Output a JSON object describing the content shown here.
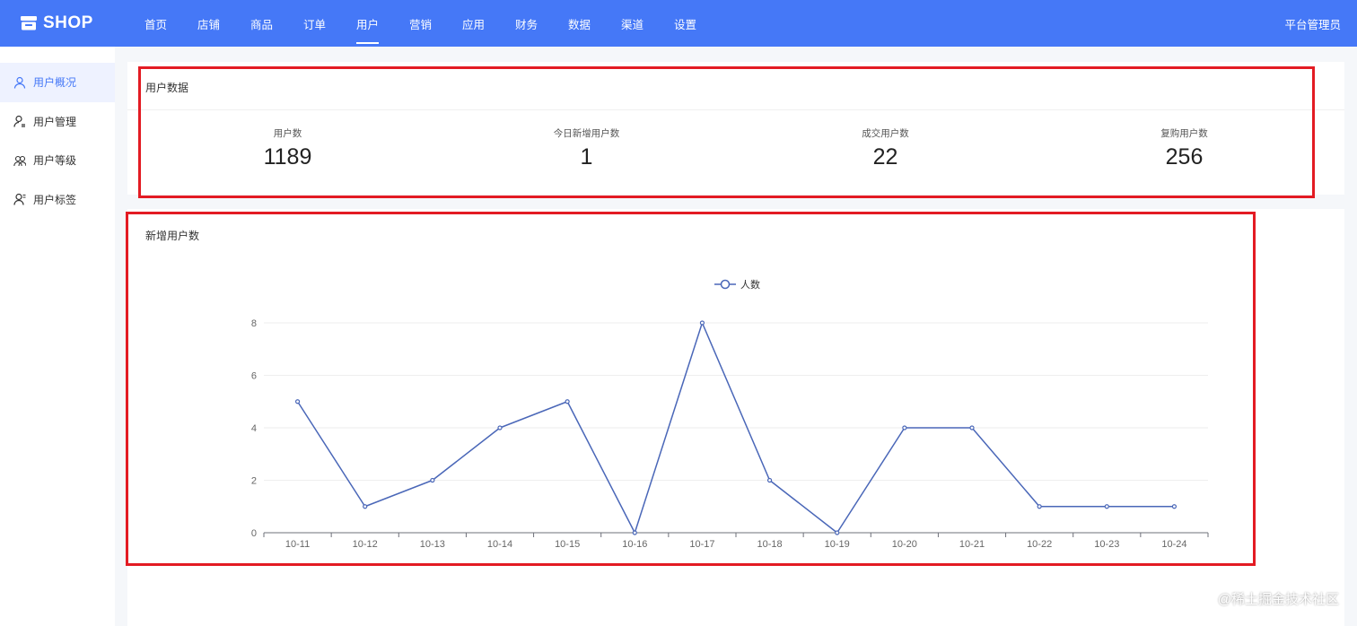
{
  "brand": {
    "name": "SHOP",
    "logo_icon": "store-icon"
  },
  "nav": [
    {
      "key": "home",
      "label": "首页"
    },
    {
      "key": "store",
      "label": "店铺"
    },
    {
      "key": "goods",
      "label": "商品"
    },
    {
      "key": "orders",
      "label": "订单"
    },
    {
      "key": "users",
      "label": "用户",
      "active": true
    },
    {
      "key": "marketing",
      "label": "营销"
    },
    {
      "key": "apps",
      "label": "应用"
    },
    {
      "key": "finance",
      "label": "财务"
    },
    {
      "key": "data",
      "label": "数据"
    },
    {
      "key": "channels",
      "label": "渠道"
    },
    {
      "key": "settings",
      "label": "设置"
    }
  ],
  "admin_label": "平台管理员",
  "sidebar": [
    {
      "key": "overview",
      "label": "用户概况",
      "icon": "user-icon",
      "active": true
    },
    {
      "key": "manage",
      "label": "用户管理",
      "icon": "user-settings-icon"
    },
    {
      "key": "level",
      "label": "用户等级",
      "icon": "users-group-icon"
    },
    {
      "key": "tags",
      "label": "用户标签",
      "icon": "user-tag-icon"
    }
  ],
  "stats_card": {
    "title": "用户数据",
    "items": [
      {
        "label": "用户数",
        "value": "1189"
      },
      {
        "label": "今日新增用户数",
        "value": "1"
      },
      {
        "label": "成交用户数",
        "value": "22"
      },
      {
        "label": "复购用户数",
        "value": "256"
      }
    ]
  },
  "chart_card": {
    "title": "新增用户数"
  },
  "chart_data": {
    "type": "line",
    "x": [
      "10-11",
      "10-12",
      "10-13",
      "10-14",
      "10-15",
      "10-16",
      "10-17",
      "10-18",
      "10-19",
      "10-20",
      "10-21",
      "10-22",
      "10-23",
      "10-24"
    ],
    "series": [
      {
        "name": "人数",
        "values": [
          5,
          1,
          2,
          4,
          5,
          0,
          8,
          2,
          0,
          4,
          4,
          1,
          1,
          1
        ]
      }
    ],
    "ylim": [
      0,
      8
    ],
    "yticks": [
      0,
      2,
      4,
      6,
      8
    ],
    "legend": "top-center",
    "grid": true,
    "colors": {
      "line": "#4a67b8",
      "grid": "#eeeeee",
      "axis": "#6e7079",
      "tick_text": "#666666"
    }
  },
  "colors": {
    "primary": "#4578f7",
    "highlight": "#e31b23"
  },
  "watermark": "@稀土掘金技术社区"
}
